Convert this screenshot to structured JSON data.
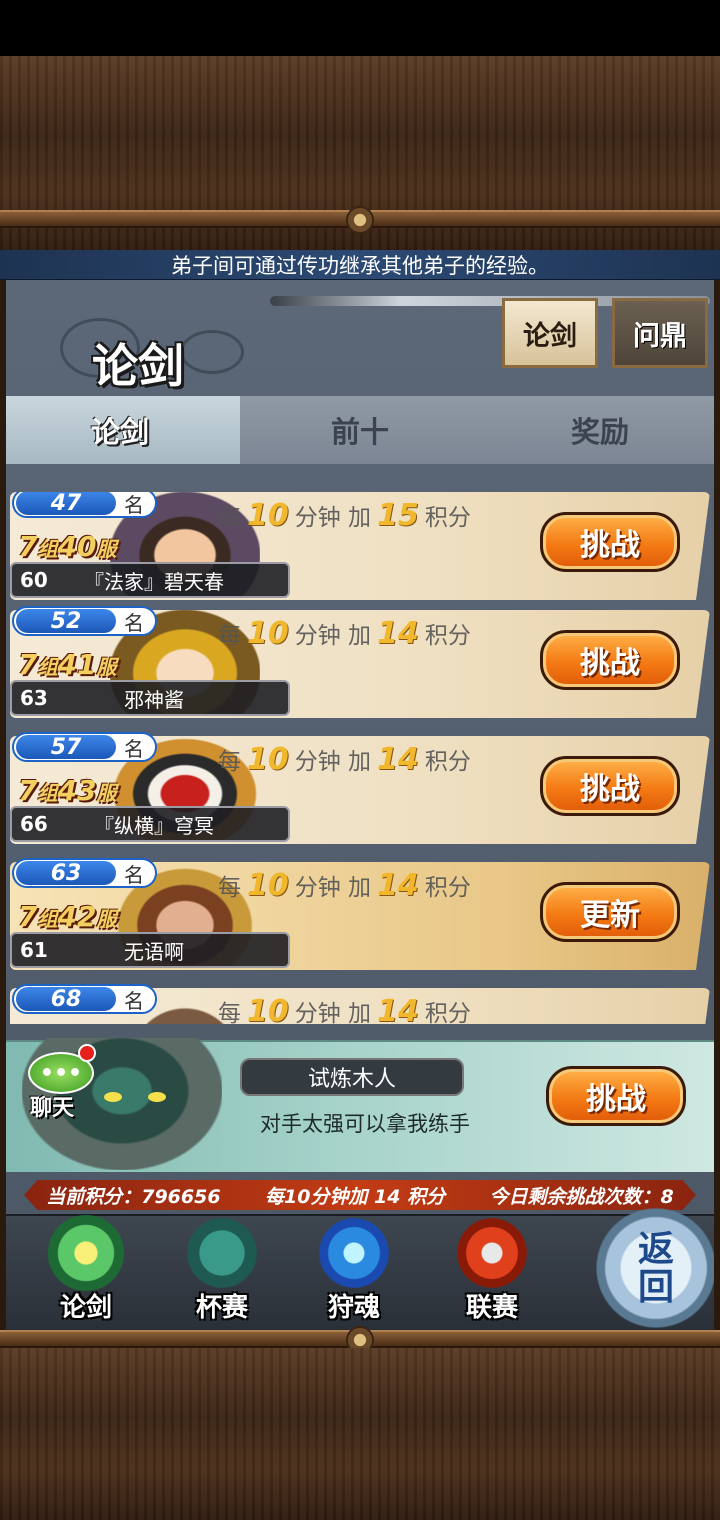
{
  "tip": "弟子间可通过传功继承其他弟子的经验。",
  "header": {
    "title": "论剑",
    "top_tabs": [
      "论剑",
      "问鼎"
    ]
  },
  "sub_tabs": [
    "论剑",
    "前十",
    "奖励"
  ],
  "gain_text": {
    "prefix": "每",
    "mid": "分钟 加",
    "suffix": "积分"
  },
  "rank_unit": "名",
  "server_group": "组",
  "server_unit": "服",
  "opponents": [
    {
      "rank": "47",
      "group": "7",
      "server": "40",
      "level": "60",
      "name": "『法家』碧天春",
      "minutes": "10",
      "points": "15",
      "button": "挑战"
    },
    {
      "rank": "52",
      "group": "7",
      "server": "41",
      "level": "63",
      "name": "邪神酱",
      "minutes": "10",
      "points": "14",
      "button": "挑战"
    },
    {
      "rank": "57",
      "group": "7",
      "server": "43",
      "level": "66",
      "name": "『纵横』穹冥",
      "minutes": "10",
      "points": "14",
      "button": "挑战"
    },
    {
      "rank": "63",
      "group": "7",
      "server": "42",
      "level": "61",
      "name": "无语啊",
      "minutes": "10",
      "points": "14",
      "button": "更新"
    },
    {
      "rank": "68",
      "minutes": "10",
      "points": "14"
    }
  ],
  "trial": {
    "name": "试炼木人",
    "desc": "对手太强可以拿我练手",
    "button": "挑战"
  },
  "chat": {
    "label": "聊天",
    "bubble": "•••"
  },
  "status": {
    "score_label": "当前积分：",
    "score": "796656",
    "rate": "每10分钟加 14 积分",
    "remaining_label": "今日剩余挑战次数：",
    "remaining": "8"
  },
  "nav": [
    "论剑",
    "杯赛",
    "狩魂",
    "联赛"
  ],
  "back": {
    "line1": "返",
    "line2": "回"
  },
  "colors": {
    "accent_orange": "#f47a14",
    "rank_blue": "#1c63c8",
    "gold": "#f2b41e"
  }
}
